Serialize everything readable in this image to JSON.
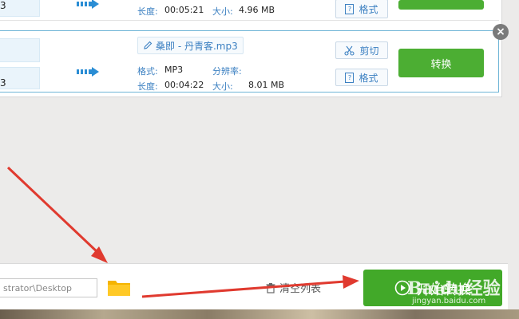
{
  "top_row": {
    "duration_label": "长度:",
    "duration_value": "00:05:21",
    "size_label": "大小:",
    "size_value": "4.96 MB",
    "format_button": "格式"
  },
  "file_row": {
    "source_frag_top": "",
    "source_frag_bottom": "3",
    "file_name": "桑即 - 丹青客.mp3",
    "format_label": "格式:",
    "format_value": "MP3",
    "resolution_label": "分辨率:",
    "resolution_value": "",
    "duration_label": "长度:",
    "duration_value": "00:04:22",
    "size_label": "大小:",
    "size_value": "8.01 MB",
    "cut_button": "剪切",
    "format_button": "格式",
    "convert_button": "转换"
  },
  "top_row_source_frag": "3",
  "bottom_bar": {
    "output_path": "strator\\Desktop",
    "clear_list": "清空列表",
    "start_convert": "开始转换"
  },
  "watermark": {
    "brand": "Baidu经验",
    "url": "jingyan.baidu.com"
  },
  "colors": {
    "accent_green": "#4cae33",
    "label_blue": "#3a7fc1",
    "annotation_red": "#e03a2f"
  },
  "icons": [
    "play-arrow-icon",
    "pencil-icon",
    "scissors-icon",
    "format-icon",
    "close-icon",
    "folder-icon",
    "trash-icon",
    "play-circle-icon"
  ]
}
